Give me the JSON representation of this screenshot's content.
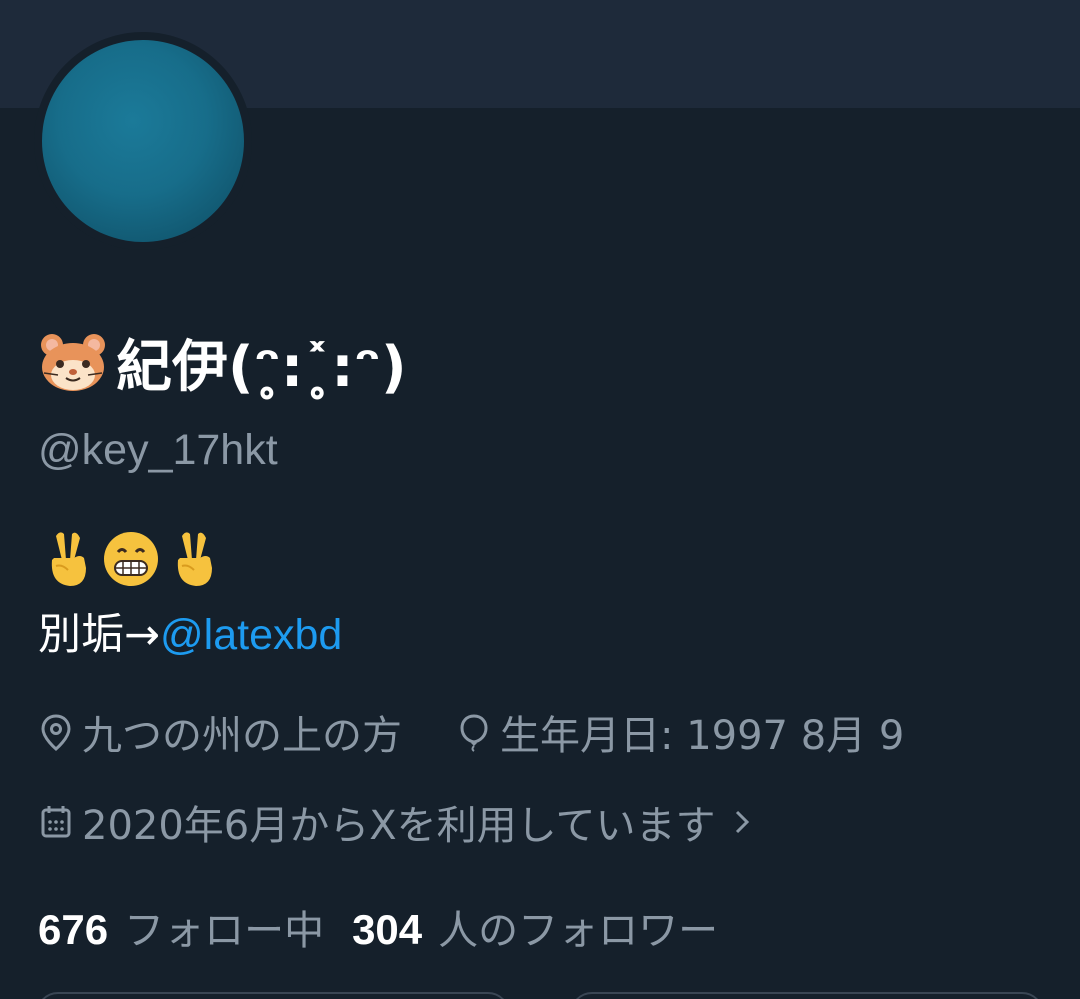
{
  "profile": {
    "display_name": "紀伊(ᵔ̥:˟̥:ᵔ)",
    "display_name_emoji": "hamster-face-icon",
    "handle": "@key_17hkt",
    "avatar_color": "#176d8a",
    "banner_color": "#1e2a3a"
  },
  "bio": {
    "emojis": [
      "victory-hand-icon",
      "grinning-face-icon",
      "victory-hand-icon"
    ],
    "line_prefix": "別垢→",
    "mention": "@latexbd"
  },
  "meta": {
    "location": "九つの州の上の方",
    "birthday": "生年月日: 1997 8月 9",
    "joined": "2020年6月からXを利用しています"
  },
  "stats": {
    "following_count": "676",
    "following_label": "フォロー中",
    "followers_count": "304",
    "followers_label": "人のフォロワー"
  },
  "colors": {
    "background": "#15202b",
    "text": "#ffffff",
    "secondary_text": "#8b98a5",
    "accent": "#1d9bf0"
  }
}
